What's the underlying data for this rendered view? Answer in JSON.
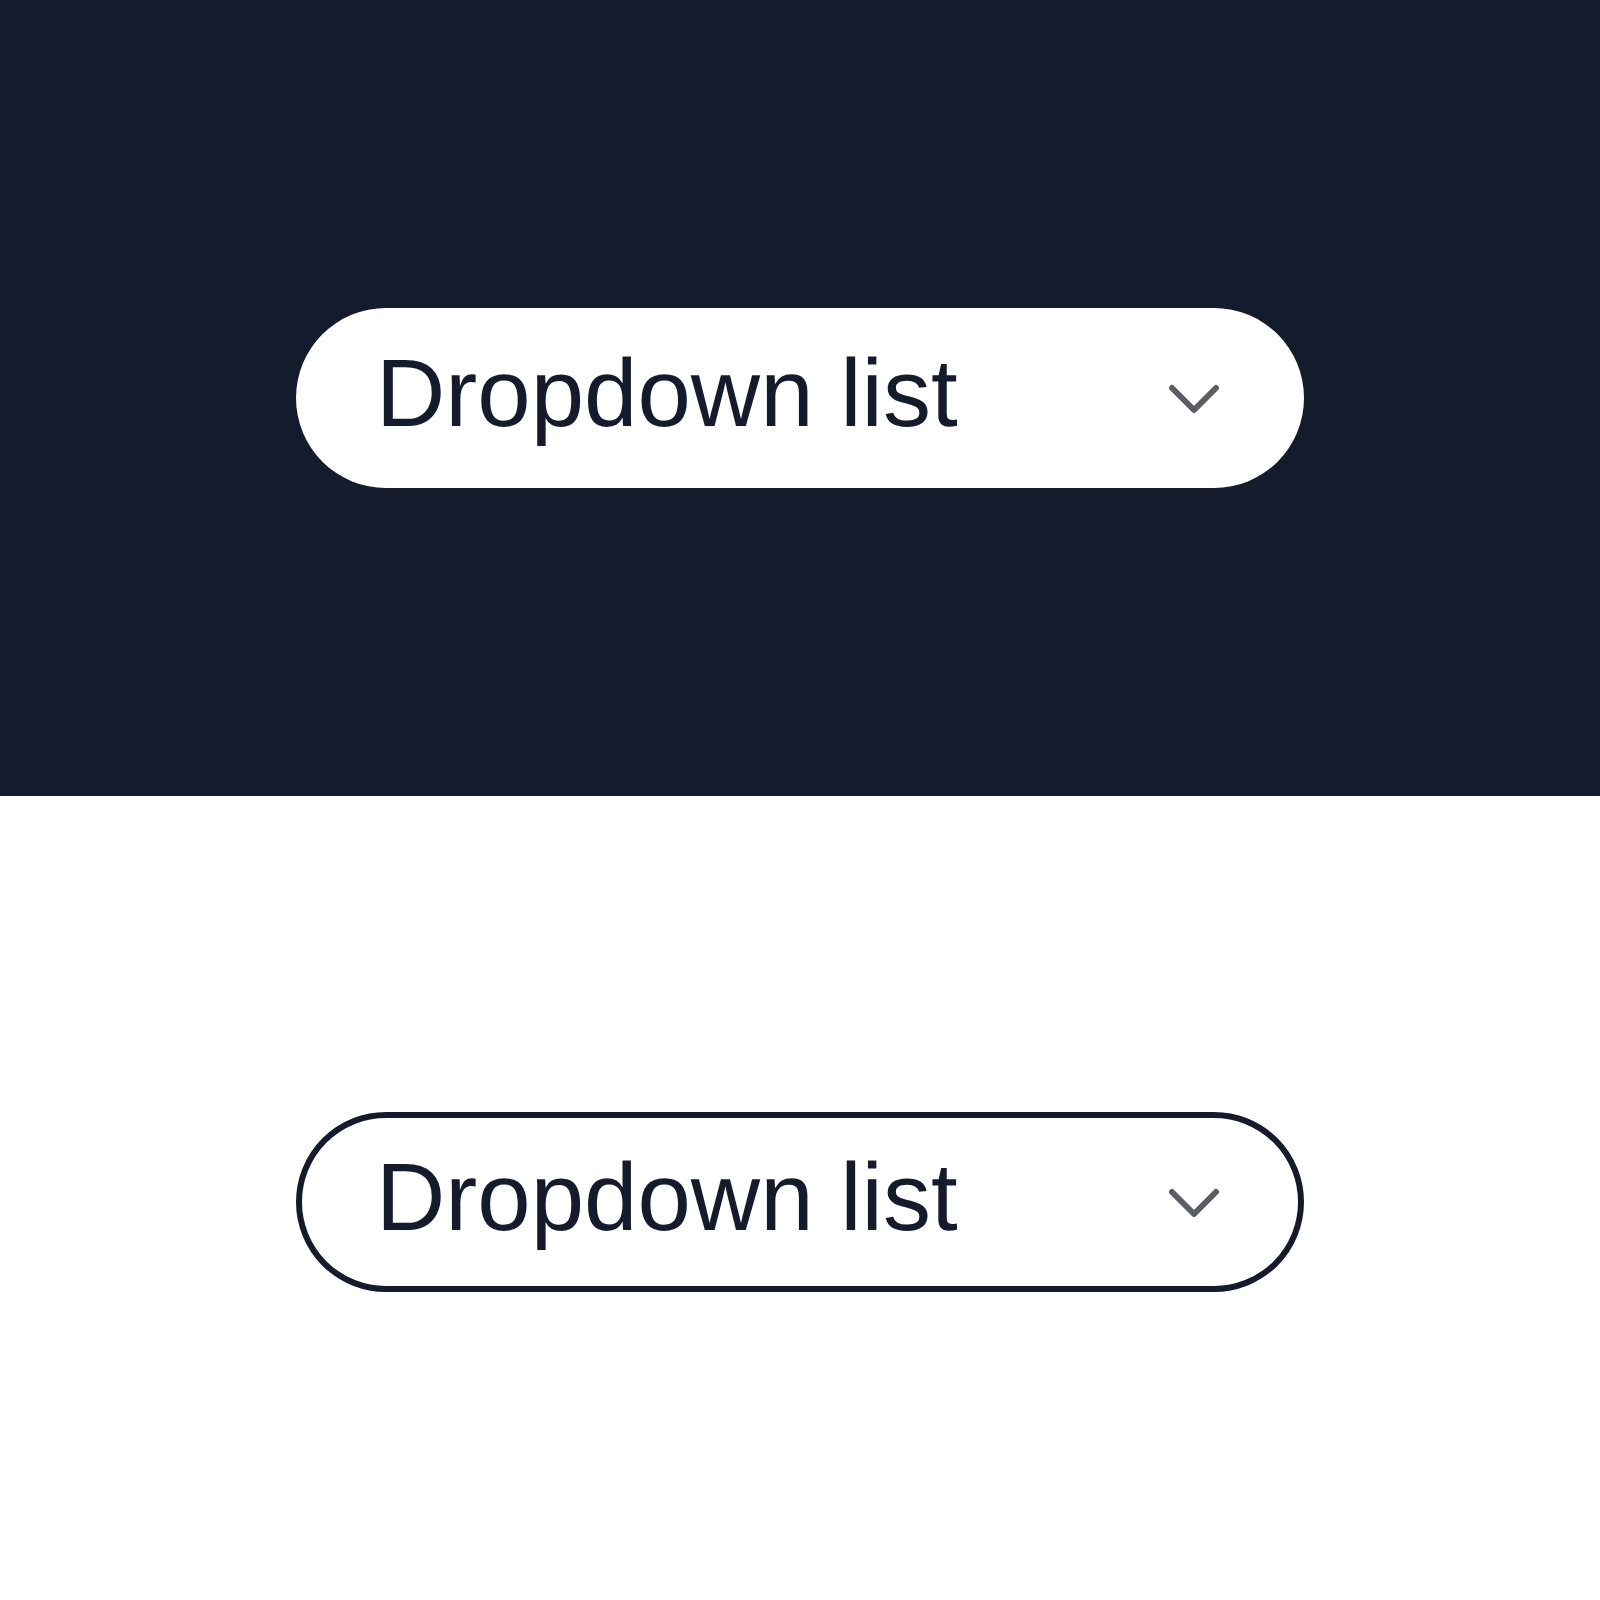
{
  "panels": [
    {
      "kind": "filled",
      "dropdown": {
        "value": "Dropdown list"
      }
    },
    {
      "kind": "outlined",
      "dropdown": {
        "value": "Dropdown list"
      }
    }
  ]
}
